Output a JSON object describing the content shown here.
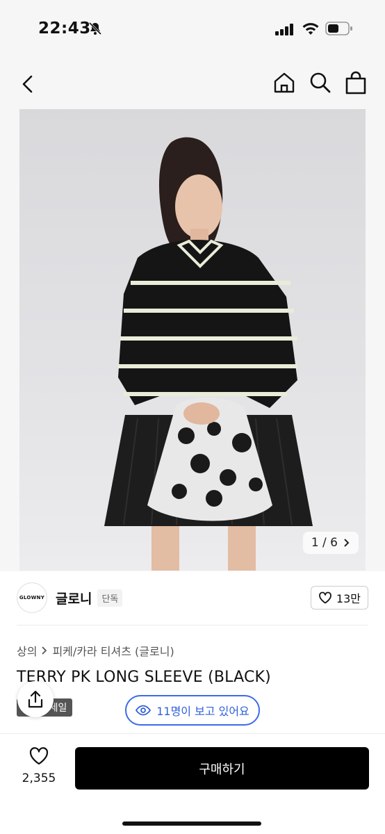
{
  "status": {
    "time": "22:43"
  },
  "gallery": {
    "counter": "1 / 6"
  },
  "brand": {
    "logo_text": "GLOWNY",
    "name": "글로니",
    "tag": "단독",
    "likes": "13만"
  },
  "breadcrumb": {
    "category": "상의",
    "sub": "피케/카라 티셔츠 (글로니)"
  },
  "product": {
    "title": "TERRY PK LONG SLEEVE (BLACK)",
    "sale_badge": "세일"
  },
  "viewers": {
    "label": "11명이 보고 있어요"
  },
  "bottom": {
    "wishlist_count": "2,355",
    "buy_label": "구매하기"
  },
  "colors": {
    "accent": "#3b6be8",
    "buy_bg": "#000000",
    "hero_bg": "#e1e1e4"
  }
}
